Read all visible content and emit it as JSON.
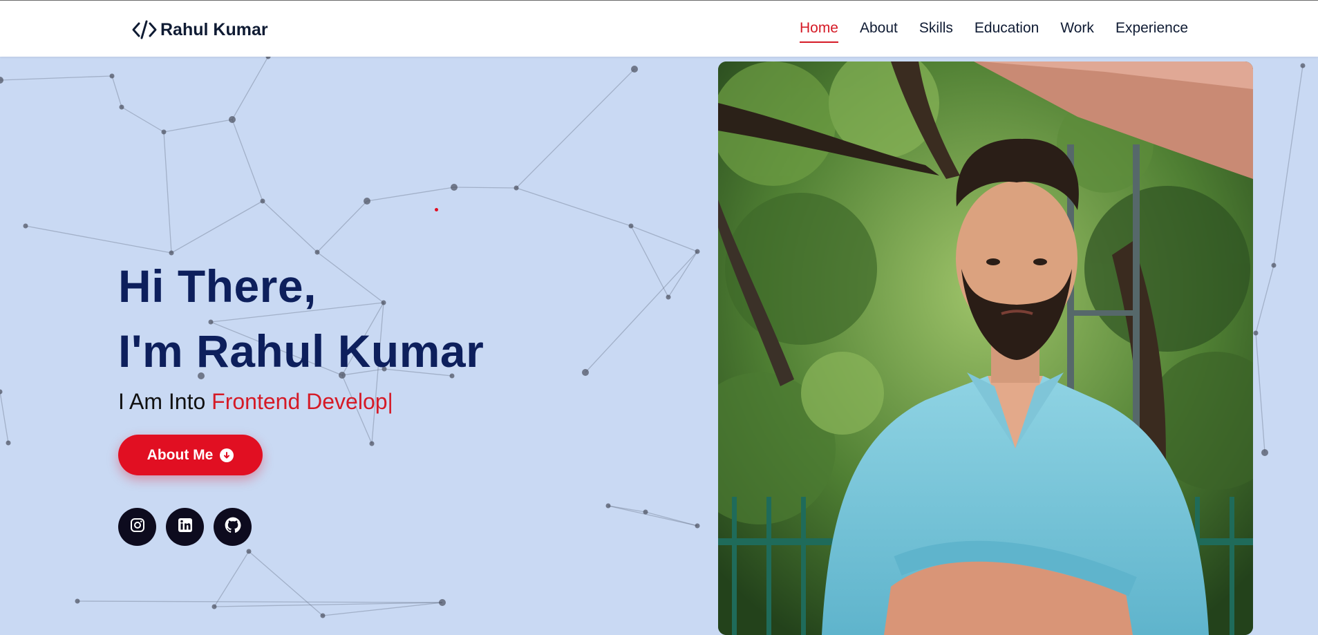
{
  "header": {
    "logo_text": "Rahul Kumar",
    "logo_icon": "code-icon",
    "nav": [
      {
        "label": "Home",
        "active": true
      },
      {
        "label": "About",
        "active": false
      },
      {
        "label": "Skills",
        "active": false
      },
      {
        "label": "Education",
        "active": false
      },
      {
        "label": "Work",
        "active": false
      },
      {
        "label": "Experience",
        "active": false
      }
    ]
  },
  "hero": {
    "greeting_line1": "Hi There,",
    "greeting_line2": "I'm Rahul Kumar",
    "tagline_prefix": "I Am Into ",
    "tagline_role": "Frontend Develop",
    "tagline_cursor": "|",
    "about_button_label": "About Me",
    "about_button_icon": "arrow-down-circle-icon",
    "socials": [
      {
        "name": "instagram-icon"
      },
      {
        "name": "linkedin-icon"
      },
      {
        "name": "github-icon"
      }
    ],
    "photo_alt": "Portrait of Rahul Kumar"
  },
  "colors": {
    "accent": "#d51a26",
    "heading": "#0d1f5c",
    "background": "#c9d9f3",
    "social_bg": "#0d0b1e"
  }
}
